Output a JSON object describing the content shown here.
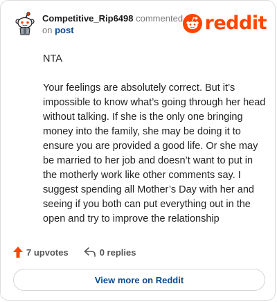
{
  "comment": {
    "author": "Competitive_Rip6498",
    "action_text": "commented",
    "on_text": "on",
    "post_link_label": "post",
    "paragraphs": [
      "NTA",
      "Your feelings are absolutely correct. But it’s impossible to know what’s going through her head without talking. If she is the only one bringing money into the family, she may be doing it to ensure you are provided a good life. Or she may be married to her job and doesn’t want to put in the motherly work like other comments say. I suggest spending all Mother’s Day with her and seeing if you both can put everything out in the open and try to improve the relationship"
    ]
  },
  "brand": {
    "wordmark": "reddit",
    "color": "#ff4500"
  },
  "actions": {
    "upvotes_label": "7 upvotes",
    "replies_label": "0 replies"
  },
  "footer": {
    "view_more_label": "View more on Reddit"
  },
  "icons": {
    "avatar": "snoo-avatar-icon",
    "logo": "reddit-snoo-icon",
    "upvote": "upvote-arrow-icon",
    "reply": "reply-arrow-icon"
  }
}
